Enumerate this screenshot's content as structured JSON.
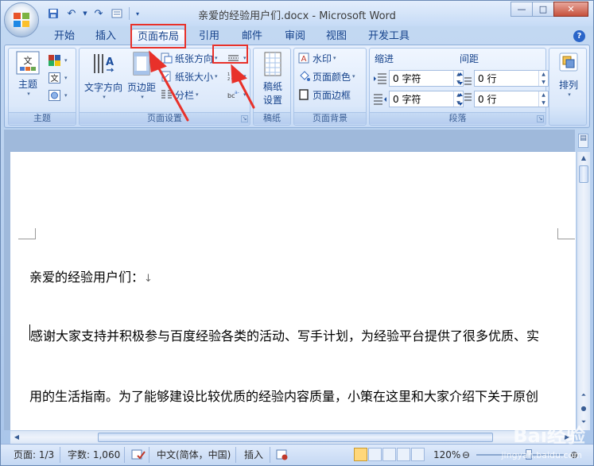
{
  "window": {
    "title": "亲爱的经验用户们.docx - Microsoft Word",
    "buttons": {
      "minimize": "—",
      "maximize": "□",
      "close": "✕"
    }
  },
  "tabs": [
    {
      "label": "开始"
    },
    {
      "label": "插入"
    },
    {
      "label": "页面布局"
    },
    {
      "label": "引用"
    },
    {
      "label": "邮件"
    },
    {
      "label": "审阅"
    },
    {
      "label": "视图"
    },
    {
      "label": "开发工具"
    }
  ],
  "ribbon": {
    "theme_group": {
      "label": "主题",
      "theme_button": "主题"
    },
    "page_setup_group": {
      "label": "页面设置",
      "text_direction": "文字方向",
      "margins": "页边距",
      "orientation": "纸张方向",
      "size": "纸张大小",
      "columns": "分栏"
    },
    "draft_group": {
      "label": "稿纸",
      "draft_settings_line1": "稿纸",
      "draft_settings_line2": "设置"
    },
    "background_group": {
      "label": "页面背景",
      "watermark": "水印",
      "page_color": "页面颜色",
      "page_border": "页面边框"
    },
    "paragraph_group": {
      "label": "段落",
      "indent_label": "缩进",
      "spacing_label": "间距",
      "indent_left": "0 字符",
      "indent_right": "0 字符",
      "spacing_before": "0 行",
      "spacing_after": "0 行"
    },
    "arrange_group": {
      "label": "排列",
      "arrange_button": "排列"
    }
  },
  "document": {
    "lines": [
      "亲爱的经验用户们：",
      "感谢大家支持并积极参与百度经验各类的活动、写手计划，为经验平台提供了很多优质、实",
      "用的生活指南。为了能够建设比较优质的经验内容质量，小策在这里和大家介绍下关于原创"
    ],
    "para_mark": "↓"
  },
  "statusbar": {
    "page": "页面: 1/3",
    "words": "字数: 1,060",
    "language": "中文(简体，中国)",
    "mode": "插入",
    "zoom": "120%"
  },
  "watermark": {
    "text": "Bai经验",
    "sub": "jingyan.baidu.com"
  },
  "colors": {
    "accent": "#15428b",
    "highlight": "#e8312a"
  }
}
